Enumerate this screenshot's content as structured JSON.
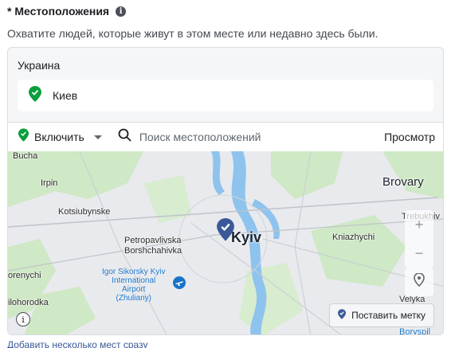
{
  "header": {
    "title": "* Местоположения",
    "info_icon": "info-icon"
  },
  "subtitle": "Охватите людей, которые живут в этом месте или недавно здесь были.",
  "location": {
    "country": "Украина",
    "selected": {
      "name": "Киев",
      "icon": "green-pin-icon"
    }
  },
  "toolbar": {
    "mode": "Включить",
    "search_placeholder": "Поиск местоположений",
    "preview": "Просмотр"
  },
  "map": {
    "center_city": "Kyiv",
    "labels": [
      "Bucha",
      "Irpin",
      "Kotsiubynske",
      "Petropavlivska",
      "Borshchahivka",
      "orenychi",
      "ilohorodka",
      "Brovary",
      "Trebukhiv",
      "Kniazhychi",
      "Velyka",
      "Boryspil"
    ],
    "airport": {
      "line1": "Igor Sikorsky Kyiv",
      "line2": "International",
      "line3": "Airport",
      "line4": "(Zhuliany)"
    },
    "zoom_in": "+",
    "zoom_out": "−",
    "drop_pin": "Поставить метку",
    "info": "i"
  },
  "bulk_link": "Добавить несколько мест сразу",
  "colors": {
    "accent_green": "#0a9e3c",
    "marker": "#3b5998",
    "link": "#385898",
    "water": "#8ec3ee",
    "greenery": "#cfe8c5"
  }
}
